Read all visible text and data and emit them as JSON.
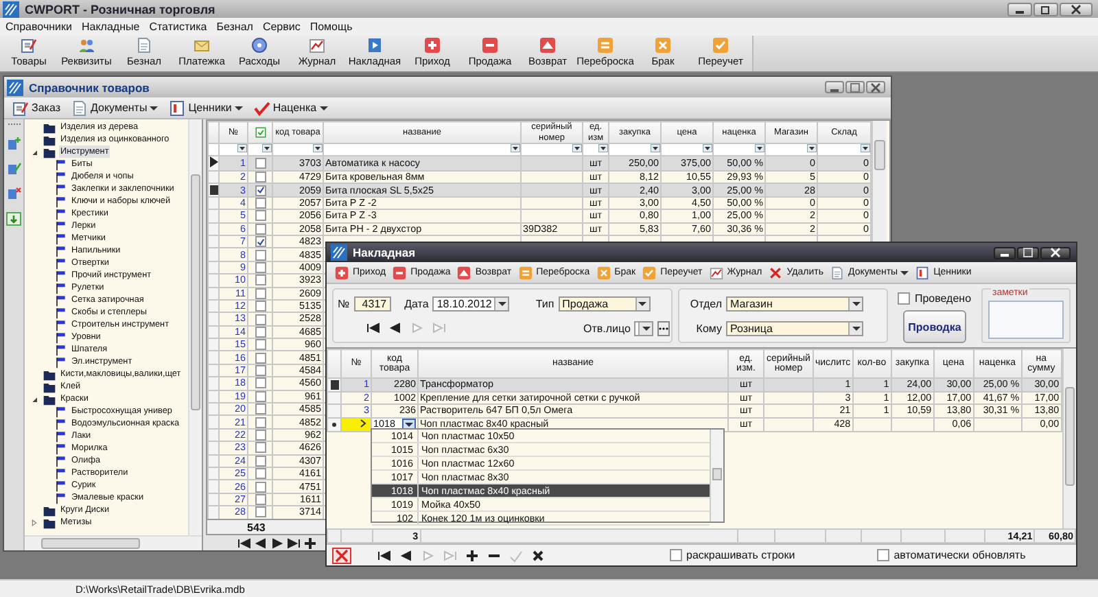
{
  "window": {
    "title": "CWPORT - Розничная торговля"
  },
  "menu": [
    "Справочники",
    "Накладные",
    "Статистика",
    "Безнал",
    "Сервис",
    "Помощь"
  ],
  "toolbar": [
    "Товары",
    "Реквизиты",
    "Безнал",
    "Платежка",
    "Расходы",
    "Журнал",
    "Накладная",
    "Приход",
    "Продажа",
    "Возврат",
    "Переброска",
    "Брак",
    "Переучет"
  ],
  "catalog": {
    "title": "Справочник товаров",
    "toolbar": [
      {
        "label": "Заказ",
        "dropdown": false
      },
      {
        "label": "Документы",
        "dropdown": true
      },
      {
        "label": "Ценники",
        "dropdown": true
      },
      {
        "label": "Наценка",
        "dropdown": true
      }
    ],
    "tree": [
      {
        "label": "Изделия из дерева",
        "selected": false
      },
      {
        "label": "Изделия из оцинкованного",
        "selected": false
      },
      {
        "label": "Инструмент",
        "selected": true,
        "expanded": true,
        "children": [
          {
            "label": "Биты",
            "selected": false
          },
          {
            "label": "Дюбеля и чопы",
            "selected": false
          },
          {
            "label": "Заклепки и заклепочники",
            "selected": false
          },
          {
            "label": "Ключи и наборы ключей",
            "selected": false
          },
          {
            "label": "Крестики",
            "selected": false
          },
          {
            "label": "Лерки",
            "selected": false
          },
          {
            "label": "Метчики",
            "selected": false
          },
          {
            "label": "Напильники",
            "selected": false
          },
          {
            "label": "Отвертки",
            "selected": false
          },
          {
            "label": "Прочий инструмент",
            "selected": false
          },
          {
            "label": "Рулетки",
            "selected": false
          },
          {
            "label": "Сетка затирочная",
            "selected": false
          },
          {
            "label": "Скобы и степлеры",
            "selected": false
          },
          {
            "label": "Строительн инструмент",
            "selected": false
          },
          {
            "label": "Уровни",
            "selected": false
          },
          {
            "label": "Шпателя",
            "selected": false
          },
          {
            "label": "Эл.инструмент",
            "selected": false
          }
        ]
      },
      {
        "label": "Кисти,макловицы,валики,щет",
        "selected": false
      },
      {
        "label": "Клей",
        "selected": false
      },
      {
        "label": "Краски",
        "selected": false,
        "expanded": true,
        "children": [
          {
            "label": "Быстросохнущая универ",
            "selected": false
          },
          {
            "label": "Водоэмульсионная краска",
            "selected": false
          },
          {
            "label": "Лаки",
            "selected": false
          },
          {
            "label": "Морилка",
            "selected": false
          },
          {
            "label": "Олифа",
            "selected": false
          },
          {
            "label": "Растворители",
            "selected": false
          },
          {
            "label": "Сурик",
            "selected": false
          },
          {
            "label": "Эмалевые краски",
            "selected": false
          }
        ]
      },
      {
        "label": "Круги Диски",
        "selected": false
      },
      {
        "label": "Метизы",
        "selected": false,
        "expanded": false
      }
    ],
    "columns": [
      "№",
      "код товара",
      "название",
      "серийный номер",
      "ед. изм",
      "закупка",
      "цена",
      "наценка",
      "Магазин",
      "Склад"
    ],
    "rows": [
      {
        "no": "1",
        "checked": false,
        "selected": true,
        "current": true,
        "code": "3703",
        "name": "Автоматика к насосу",
        "unit": "шт",
        "cost": "250,00",
        "price": "375,00",
        "markup": "50,00 %",
        "shop": "0",
        "stock": "0"
      },
      {
        "no": "2",
        "checked": false,
        "selected": false,
        "code": "4729",
        "name": "Бита кровельная 8мм",
        "unit": "шт",
        "cost": "8,12",
        "price": "10,55",
        "markup": "29,93 %",
        "shop": "5",
        "stock": "0"
      },
      {
        "no": "3",
        "checked": true,
        "selected": true,
        "code": "2059",
        "name": "Бита плоская SL 5,5х25",
        "unit": "шт",
        "cost": "2,40",
        "price": "3,00",
        "markup": "25,00 %",
        "shop": "28",
        "stock": "0"
      },
      {
        "no": "4",
        "checked": false,
        "selected": false,
        "code": "2057",
        "name": "Бита P Z -2",
        "unit": "шт",
        "cost": "3,00",
        "price": "4,50",
        "markup": "50,00 %",
        "shop": "0",
        "stock": "0"
      },
      {
        "no": "5",
        "checked": false,
        "selected": false,
        "code": "2056",
        "name": "Бита P Z -3",
        "unit": "шт",
        "cost": "0,80",
        "price": "1,00",
        "markup": "25,00 %",
        "shop": "2",
        "stock": "0"
      },
      {
        "no": "6",
        "checked": false,
        "selected": false,
        "code": "2058",
        "name": "Бита PH - 2 двухстор",
        "serial": "39D382",
        "unit": "шт",
        "cost": "5,83",
        "price": "7,60",
        "markup": "30,36 %",
        "shop": "2",
        "stock": "0"
      },
      {
        "no": "7",
        "checked": true,
        "selected": false,
        "code": "4823"
      },
      {
        "no": "8",
        "checked": false,
        "selected": false,
        "code": "4835"
      },
      {
        "no": "9",
        "checked": false,
        "selected": false,
        "code": "4009"
      },
      {
        "no": "10",
        "checked": false,
        "selected": false,
        "code": "3923"
      },
      {
        "no": "11",
        "checked": false,
        "selected": false,
        "code": "2609"
      },
      {
        "no": "12",
        "checked": false,
        "selected": false,
        "code": "5135"
      },
      {
        "no": "13",
        "checked": false,
        "selected": false,
        "code": "2528"
      },
      {
        "no": "14",
        "checked": false,
        "selected": false,
        "code": "4685"
      },
      {
        "no": "15",
        "checked": false,
        "selected": false,
        "code": "960"
      },
      {
        "no": "16",
        "checked": false,
        "selected": false,
        "code": "4851"
      },
      {
        "no": "17",
        "checked": false,
        "selected": false,
        "code": "4584"
      },
      {
        "no": "18",
        "checked": false,
        "selected": false,
        "code": "4560"
      },
      {
        "no": "19",
        "checked": false,
        "selected": false,
        "code": "961"
      },
      {
        "no": "20",
        "checked": false,
        "selected": false,
        "code": "4585"
      },
      {
        "no": "21",
        "checked": false,
        "selected": false,
        "code": "4852"
      },
      {
        "no": "22",
        "checked": false,
        "selected": false,
        "code": "962"
      },
      {
        "no": "23",
        "checked": false,
        "selected": false,
        "code": "4626"
      },
      {
        "no": "24",
        "checked": false,
        "selected": false,
        "code": "4307"
      },
      {
        "no": "25",
        "checked": false,
        "selected": false,
        "code": "4161"
      },
      {
        "no": "26",
        "checked": false,
        "selected": false,
        "code": "4751"
      },
      {
        "no": "27",
        "checked": false,
        "selected": false,
        "code": "1611"
      },
      {
        "no": "28",
        "checked": false,
        "selected": false,
        "code": "3714"
      }
    ],
    "total": "543",
    "nav": [
      {
        "kind": "first",
        "disabled": false
      },
      {
        "kind": "prev",
        "disabled": false
      },
      {
        "kind": "next",
        "disabled": false
      },
      {
        "kind": "last",
        "disabled": false
      },
      {
        "kind": "insert",
        "disabled": false
      }
    ]
  },
  "invoice": {
    "title": "Накладная",
    "toolbar": [
      {
        "label": "Приход",
        "dropdown": false
      },
      {
        "label": "Продажа",
        "dropdown": false
      },
      {
        "label": "Возврат",
        "dropdown": false
      },
      {
        "label": "Переброска",
        "dropdown": false
      },
      {
        "label": "Брак",
        "dropdown": false
      },
      {
        "label": "Переучет",
        "dropdown": false
      },
      {
        "label": "Журнал",
        "dropdown": false
      },
      {
        "label": "Удалить",
        "dropdown": false
      },
      {
        "label": "Документы",
        "dropdown": true
      },
      {
        "label": "Ценники",
        "dropdown": false
      }
    ],
    "number": {
      "label": "№",
      "value": "4317"
    },
    "date": {
      "label": "Дата",
      "value": "18.10.2012"
    },
    "type": {
      "label": "Тип",
      "value": "Продажа"
    },
    "responsible": {
      "label": "Отв.лицо"
    },
    "department": {
      "label": "Отдел",
      "value": "Магазин"
    },
    "recipient": {
      "label": "Кому",
      "value": "Розница"
    },
    "posted": {
      "label": "Проведено",
      "checked": false
    },
    "post_button": "Проводка",
    "notes": {
      "label": "заметки"
    },
    "form_nav": [
      {
        "kind": "first",
        "disabled": false
      },
      {
        "kind": "prev",
        "disabled": false
      },
      {
        "kind": "next",
        "disabled": true
      },
      {
        "kind": "last",
        "disabled": true
      }
    ],
    "columns": [
      "№",
      "код товара",
      "название",
      "ед. изм.",
      "серийный номер",
      "числитс",
      "кол-во",
      "закупка",
      "цена",
      "наценка",
      "на сумму"
    ],
    "rows": [
      {
        "no": "1",
        "selected": true,
        "editing": false,
        "code": "2280",
        "name": "Трансформатор",
        "unit": "шт",
        "stock": "1",
        "qty": "1",
        "cost": "24,00",
        "price": "30,00",
        "markup": "25,00 %",
        "sum": "30,00"
      },
      {
        "no": "2",
        "selected": false,
        "editing": false,
        "code": "1002",
        "name": "Крепление для сетки затирочной  сетки с ручкой",
        "unit": "шт",
        "stock": "3",
        "qty": "1",
        "cost": "12,00",
        "price": "17,00",
        "markup": "41,67 %",
        "sum": "17,00"
      },
      {
        "no": "3",
        "selected": false,
        "editing": false,
        "code": "236",
        "name": "Растворитель 647 БП 0,5л Омега",
        "unit": "шт",
        "stock": "21",
        "qty": "1",
        "cost": "10,59",
        "price": "13,80",
        "markup": "30,31 %",
        "sum": "13,80"
      },
      {
        "selected": false,
        "editing": true,
        "code": "1018",
        "name": "Чоп пластмас  8х40 красный",
        "unit": "шт",
        "stock": "428",
        "price": "0,06",
        "sum": "0,00"
      }
    ],
    "dropdown": [
      {
        "code": "1014",
        "name": "Чоп пластмас 10х50",
        "selected": false
      },
      {
        "code": "1015",
        "name": "Чоп пластмас  6х30",
        "selected": false
      },
      {
        "code": "1016",
        "name": "Чоп пластмас 12х60",
        "selected": false
      },
      {
        "code": "1017",
        "name": "Чоп пластмас  8х30",
        "selected": false
      },
      {
        "code": "1018",
        "name": "Чоп пластмас  8х40 красный",
        "selected": true
      },
      {
        "code": "1019",
        "name": "Мойка 40х50",
        "selected": false
      },
      {
        "code": "102",
        "name": "Конек 120  1м из оцинковки",
        "selected": false
      }
    ],
    "footer": {
      "count": "3",
      "markup": "14,21",
      "sum": "60,80"
    },
    "nav": [
      {
        "kind": "first",
        "disabled": false
      },
      {
        "kind": "prev",
        "disabled": false
      },
      {
        "kind": "next",
        "disabled": true
      },
      {
        "kind": "last",
        "disabled": true
      },
      {
        "kind": "insert",
        "disabled": false
      },
      {
        "kind": "delete",
        "disabled": false
      },
      {
        "kind": "post",
        "disabled": true
      },
      {
        "kind": "cancel",
        "disabled": false
      }
    ],
    "options": [
      {
        "label": "раскрашивать строки",
        "checked": false
      },
      {
        "label": "автоматически обновлять",
        "checked": false
      }
    ]
  },
  "status_bar": "D:\\Works\\RetailTrade\\DB\\Evrika.mdb"
}
